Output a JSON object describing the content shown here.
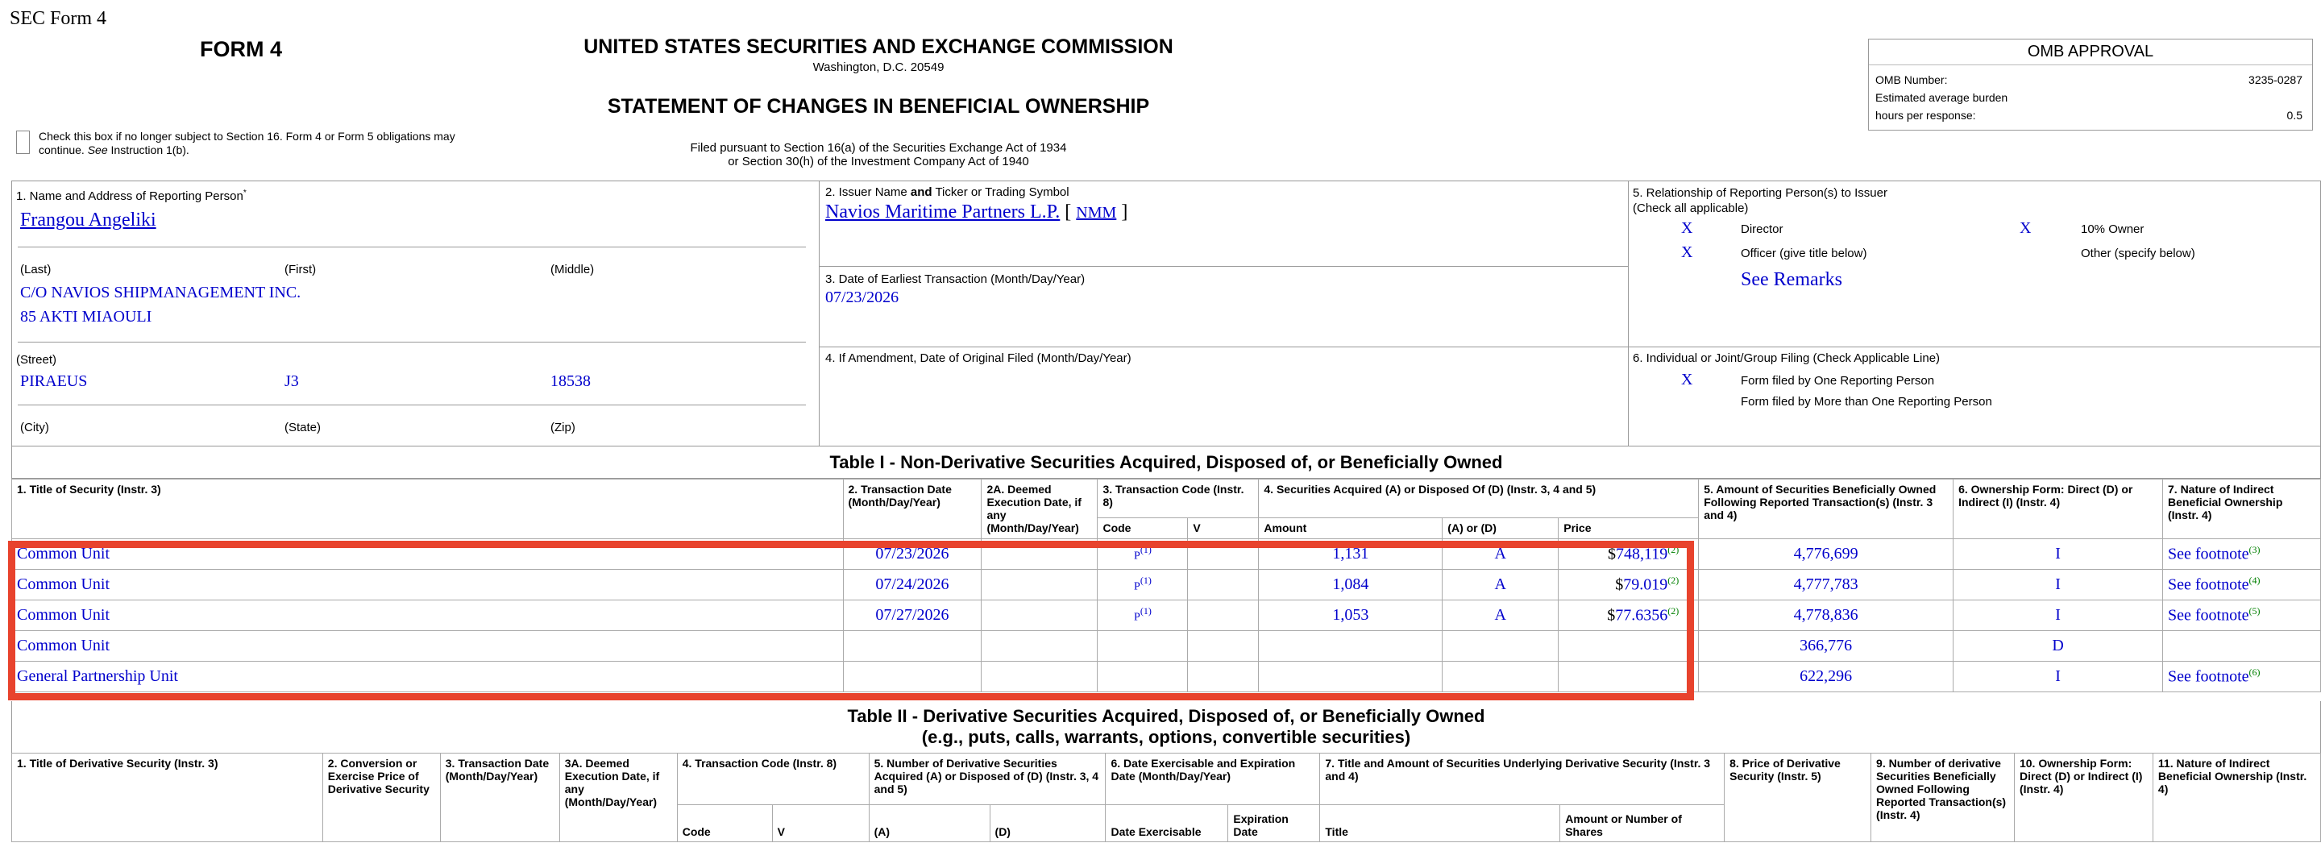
{
  "header": {
    "sec_form": "SEC Form 4",
    "form_title": "FORM 4",
    "agency": "UNITED STATES SECURITIES AND EXCHANGE COMMISSION",
    "agency_location": "Washington, D.C. 20549",
    "statement_title": "STATEMENT OF CHANGES IN BENEFICIAL OWNERSHIP",
    "filed_pursuant_1": "Filed pursuant to Section 16(a) of the Securities Exchange Act of 1934",
    "filed_pursuant_2": "or Section 30(h) of the Investment Company Act of 1940",
    "checkbox_text_1": "Check this box if no longer subject to Section 16. Form 4 or Form 5 obligations may",
    "checkbox_text_2a": "continue. ",
    "checkbox_text_2b": "See",
    "checkbox_text_2c": " Instruction 1(b)."
  },
  "omb": {
    "title": "OMB APPROVAL",
    "number_label": "OMB Number:",
    "number_value": "3235-0287",
    "burden_label": "Estimated average burden",
    "hours_label": "hours per response:",
    "hours_value": "0.5"
  },
  "reporting_person": {
    "section_label": "1. Name and Address of Reporting Person",
    "asterisk": "*",
    "name": "Frangou Angeliki",
    "last_label": "(Last)",
    "first_label": "(First)",
    "middle_label": "(Middle)",
    "address_1": "C/O NAVIOS SHIPMANAGEMENT INC.",
    "address_2": "85 AKTI MIAOULI",
    "street_label": "(Street)",
    "city": "PIRAEUS",
    "state": "J3",
    "zip": "18538",
    "city_label": "(City)",
    "state_label": "(State)",
    "zip_label": "(Zip)"
  },
  "issuer": {
    "label_a": "2. Issuer Name ",
    "label_b": "and",
    "label_c": " Ticker or Trading Symbol",
    "name": "Navios Maritime Partners L.P.",
    "bracket_open": "[",
    "ticker": "NMM",
    "bracket_close": "]"
  },
  "earliest_transaction": {
    "label": "3. Date of Earliest Transaction (Month/Day/Year)",
    "value": "07/23/2026"
  },
  "amendment": {
    "label": "4. If Amendment, Date of Original Filed (Month/Day/Year)"
  },
  "relationship": {
    "label_1": "5. Relationship of Reporting Person(s) to Issuer",
    "label_2": "(Check all applicable)",
    "director_mark": "X",
    "director_label": "Director",
    "owner_mark": "X",
    "owner_label": "10% Owner",
    "officer_mark": "X",
    "officer_label": "Officer (give title below)",
    "other_label": "Other (specify below)",
    "officer_title": "See Remarks"
  },
  "filing": {
    "label": "6. Individual or Joint/Group Filing (Check Applicable Line)",
    "one_mark": "X",
    "one_label": "Form filed by One Reporting Person",
    "more_label": "Form filed by More than One Reporting Person"
  },
  "table1": {
    "title": "Table I - Non-Derivative Securities Acquired, Disposed of, or Beneficially Owned",
    "headers": {
      "c1": "1. Title of Security (Instr. 3)",
      "c2": "2. Transaction Date (Month/Day/Year)",
      "c2a": "2A. Deemed Execution Date, if any (Month/Day/Year)",
      "c3": "3. Transaction Code (Instr. 8)",
      "c4": "4. Securities Acquired (A) or Disposed Of (D) (Instr. 3, 4 and 5)",
      "c5": "5. Amount of Securities Beneficially Owned Following Reported Transaction(s) (Instr. 3 and 4)",
      "c6": "6. Ownership Form: Direct (D) or Indirect (I) (Instr. 4)",
      "c7": "7. Nature of Indirect Beneficial Ownership (Instr. 4)",
      "code": "Code",
      "v": "V",
      "amount": "Amount",
      "aord": "(A) or (D)",
      "price": "Price"
    },
    "rows": [
      {
        "title": "Common Unit",
        "date": "07/23/2026",
        "deemed": "",
        "code": "P",
        "code_fn": "(1)",
        "v": "",
        "amount": "1,131",
        "aord": "A",
        "price_sym": "$",
        "price": "748,119",
        "price_fn": "(2)",
        "owned": "4,776,699",
        "form": "I",
        "nature": "See footnote",
        "nature_fn": "(3)"
      },
      {
        "title": "Common Unit",
        "date": "07/24/2026",
        "deemed": "",
        "code": "P",
        "code_fn": "(1)",
        "v": "",
        "amount": "1,084",
        "aord": "A",
        "price_sym": "$",
        "price": "79.019",
        "price_fn": "(2)",
        "owned": "4,777,783",
        "form": "I",
        "nature": "See footnote",
        "nature_fn": "(4)"
      },
      {
        "title": "Common Unit",
        "date": "07/27/2026",
        "deemed": "",
        "code": "P",
        "code_fn": "(1)",
        "v": "",
        "amount": "1,053",
        "aord": "A",
        "price_sym": "$",
        "price": "77.6356",
        "price_fn": "(2)",
        "owned": "4,778,836",
        "form": "I",
        "nature": "See footnote",
        "nature_fn": "(5)"
      },
      {
        "title": "Common Unit",
        "date": "",
        "deemed": "",
        "code": "",
        "code_fn": "",
        "v": "",
        "amount": "",
        "aord": "",
        "price_sym": "",
        "price": "",
        "price_fn": "",
        "owned": "366,776",
        "form": "D",
        "nature": "",
        "nature_fn": ""
      },
      {
        "title": "General Partnership Unit",
        "date": "",
        "deemed": "",
        "code": "",
        "code_fn": "",
        "v": "",
        "amount": "",
        "aord": "",
        "price_sym": "",
        "price": "",
        "price_fn": "",
        "owned": "622,296",
        "form": "I",
        "nature": "See footnote",
        "nature_fn": "(6)"
      }
    ]
  },
  "table2": {
    "title_1": "Table II - Derivative Securities Acquired, Disposed of, or Beneficially Owned",
    "title_2": "(e.g., puts, calls, warrants, options, convertible securities)",
    "headers": {
      "c1": "1. Title of Derivative Security (Instr. 3)",
      "c2": "2. Conversion or Exercise Price of Derivative Security",
      "c3": "3. Transaction Date (Month/Day/Year)",
      "c3a": "3A. Deemed Execution Date, if any (Month/Day/Year)",
      "c4": "4. Transaction Code (Instr. 8)",
      "c5": "5. Number of Derivative Securities Acquired (A) or Disposed of (D) (Instr. 3, 4 and 5)",
      "c6": "6. Date Exercisable and Expiration Date (Month/Day/Year)",
      "c7": "7. Title and Amount of Securities Underlying Derivative Security (Instr. 3 and 4)",
      "c8": "8. Price of Derivative Security (Instr. 5)",
      "c9": "9. Number of derivative Securities Beneficially Owned Following Reported Transaction(s) (Instr. 4)",
      "c10": "10. Ownership Form: Direct (D) or Indirect (I) (Instr. 4)",
      "c11": "11. Nature of Indirect Beneficial Ownership (Instr. 4)",
      "code": "Code",
      "v": "V",
      "a": "(A)",
      "d": "(D)",
      "date_ex": "Date Exercisable",
      "exp": "Expiration Date",
      "title": "Title",
      "amount_shares": "Amount or Number of Shares"
    }
  },
  "highlight": {
    "color": "#e8432d"
  }
}
